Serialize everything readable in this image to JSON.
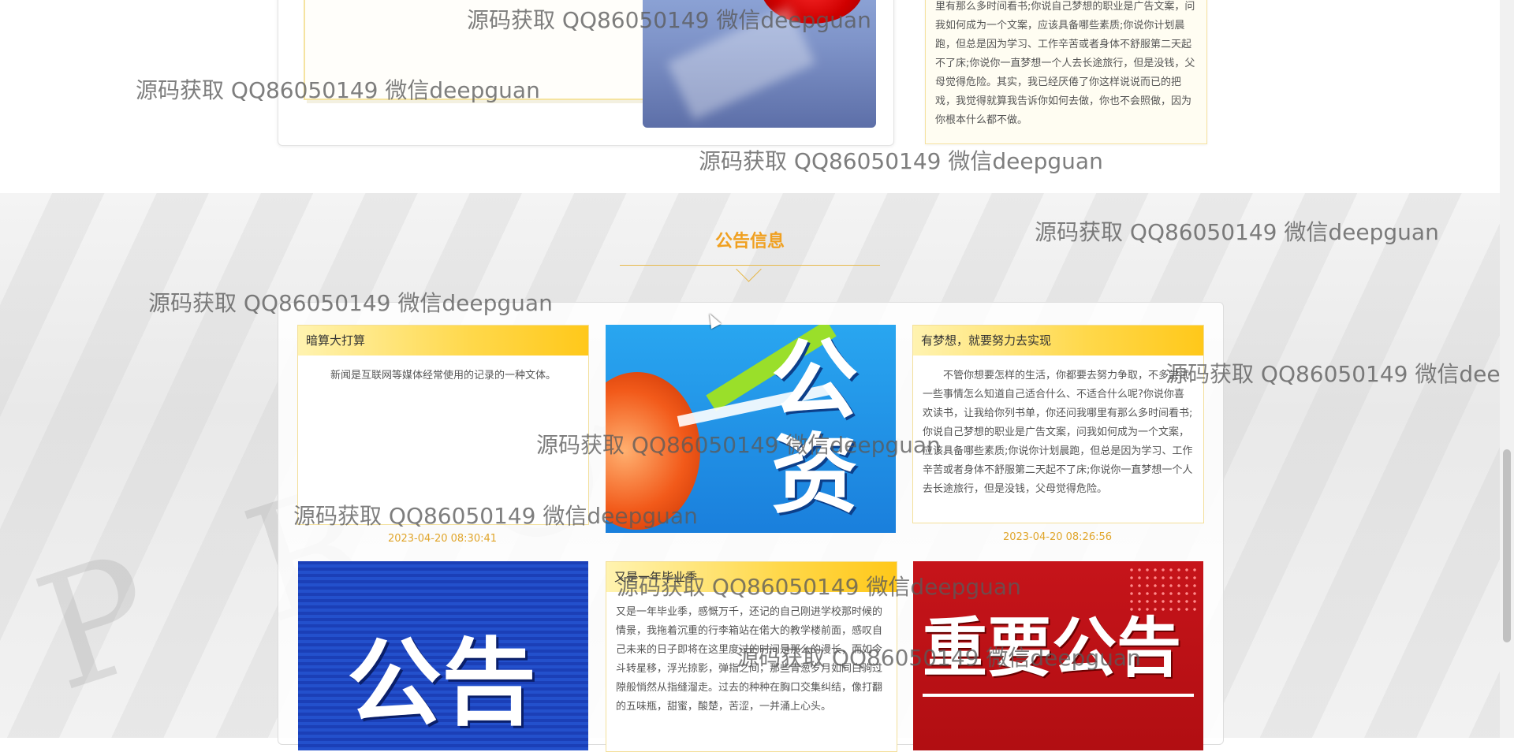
{
  "top": {
    "right_card_text": "里有那么多时间看书;你说自己梦想的职业是广告文案，问我如何成为一个文案，应该具备哪些素质;你说你计划晨跑，但总是因为学习、工作辛苦或者身体不舒服第二天起不了床;你说你一直梦想一个人去长途旅行，但是没钱，父母觉得危险。其实，我已经厌倦了你这样说说而已的把戏，我觉得就算我告诉你如何去做，你也不会照做，因为你根本什么都不做。"
  },
  "section": {
    "title": "公告信息"
  },
  "notices": [
    {
      "title": "暗算大打算",
      "body": "新闻是互联网等媒体经常使用的记录的一种文体。",
      "date": "2023-04-20 08:30:41"
    },
    {
      "image_text": "公告资讯"
    },
    {
      "title": "有梦想，就要努力去实现",
      "body": "不管你想要怎样的生活，你都要去努力争取，不多尝试一些事情怎么知道自己适合什么、不适合什么呢?你说你喜欢读书，让我给你列书单，你还问我哪里有那么多时间看书;你说自己梦想的职业是广告文案，问我如何成为一个文案，应该具备哪些素质;你说你计划晨跑，但总是因为学习、工作辛苦或者身体不舒服第二天起不了床;你说你一直梦想一个人去长途旅行，但是没钱，父母觉得危险。",
      "date": "2023-04-20 08:26:56"
    },
    {
      "image_text": "公告"
    },
    {
      "title": "又是一年毕业季",
      "body": "又是一年毕业季，感慨万千，还记的自己刚进学校那时候的情景，我拖着沉重的行李箱站在偌大的教学楼前面，感叹自己未来的日子即将在这里度过的时间是那么的漫长，而如今斗转星移，浮光掠影，弹指之间，那些青葱岁月如同白驹过隙般悄然从指缝溜走。过去的种种在胸口交集纠结，像打翻的五味瓶，甜蜜，酸楚，苦涩，一并涌上心头。"
    },
    {
      "image_text": "重要公告"
    }
  ],
  "watermark": "源码获取 QQ86050149 微信deepguan",
  "colors": {
    "accent": "#f0a020",
    "card_head": "#ffd84a",
    "date": "#e0a52a"
  }
}
